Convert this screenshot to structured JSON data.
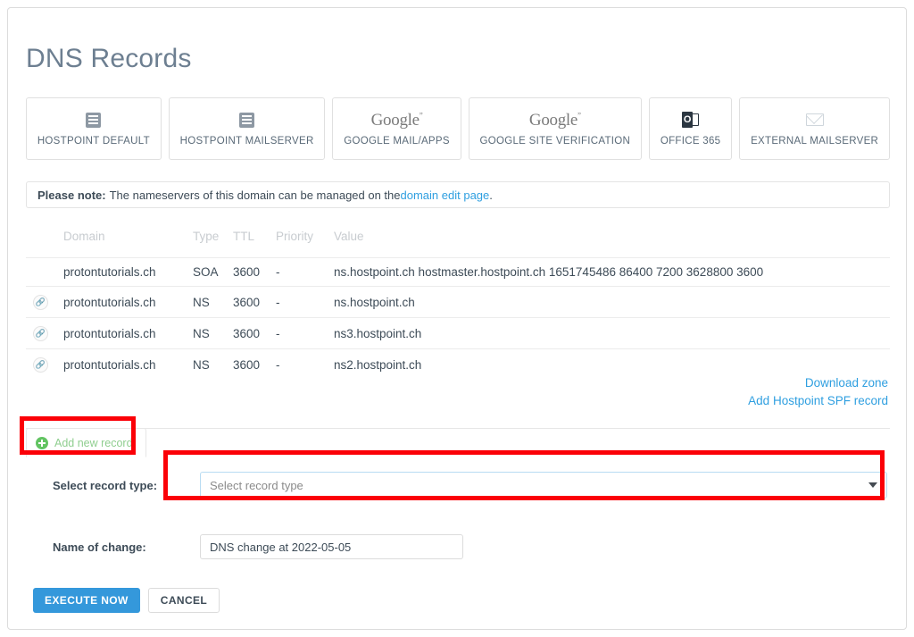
{
  "page": {
    "title": "DNS Records"
  },
  "presets": [
    {
      "label": "HOSTPOINT DEFAULT",
      "icon": "document-list-icon"
    },
    {
      "label": "HOSTPOINT MAILSERVER",
      "icon": "document-list-icon"
    },
    {
      "label": "GOOGLE MAIL/APPS",
      "icon": "google-logo-icon",
      "logo_text": "Google"
    },
    {
      "label": "GOOGLE SITE VERIFICATION",
      "icon": "google-logo-icon",
      "logo_text": "Google"
    },
    {
      "label": "OFFICE 365",
      "icon": "office365-icon",
      "logo_text": "O"
    },
    {
      "label": "EXTERNAL MAILSERVER",
      "icon": "envelope-icon"
    }
  ],
  "note": {
    "prefix": "Please note:",
    "text_before": " The nameservers of this domain can be managed on the ",
    "link_text": "domain edit page",
    "text_after": "."
  },
  "table": {
    "headers": [
      "",
      "Domain",
      "Type",
      "TTL",
      "Priority",
      "Value"
    ],
    "rows": [
      {
        "has_link_icon": false,
        "link_icon": "",
        "domain": "protontutorials.ch",
        "type": "SOA",
        "ttl": "3600",
        "priority": "-",
        "value": "ns.hostpoint.ch hostmaster.hostpoint.ch 1651745486 86400 7200 3628800 3600"
      },
      {
        "has_link_icon": true,
        "link_icon": "&#128279;",
        "domain": "protontutorials.ch",
        "type": "NS",
        "ttl": "3600",
        "priority": "-",
        "value": "ns.hostpoint.ch"
      },
      {
        "has_link_icon": true,
        "link_icon": "&#128279;",
        "domain": "protontutorials.ch",
        "type": "NS",
        "ttl": "3600",
        "priority": "-",
        "value": "ns3.hostpoint.ch"
      },
      {
        "has_link_icon": true,
        "link_icon": "&#128279;",
        "domain": "protontutorials.ch",
        "type": "NS",
        "ttl": "3600",
        "priority": "-",
        "value": "ns2.hostpoint.ch"
      }
    ]
  },
  "zone_links": {
    "download_zone": "Download zone",
    "add_spf": "Add Hostpoint SPF record"
  },
  "form": {
    "tab_label": "Add new record",
    "tab_icon": "plus-circle-icon",
    "record_type_label": "Select record type:",
    "record_type_value": "Select record type",
    "name_of_change_label": "Name of change:",
    "name_of_change_value": "DNS change at 2022-05-05"
  },
  "actions": {
    "execute": "EXECUTE NOW",
    "cancel": "CANCEL"
  },
  "colors": {
    "accent_blue": "#3498db",
    "link_blue": "#2f9fe0",
    "green": "#62c462",
    "annotation_red": "#fb0007",
    "title_gray": "#6d7f91"
  }
}
